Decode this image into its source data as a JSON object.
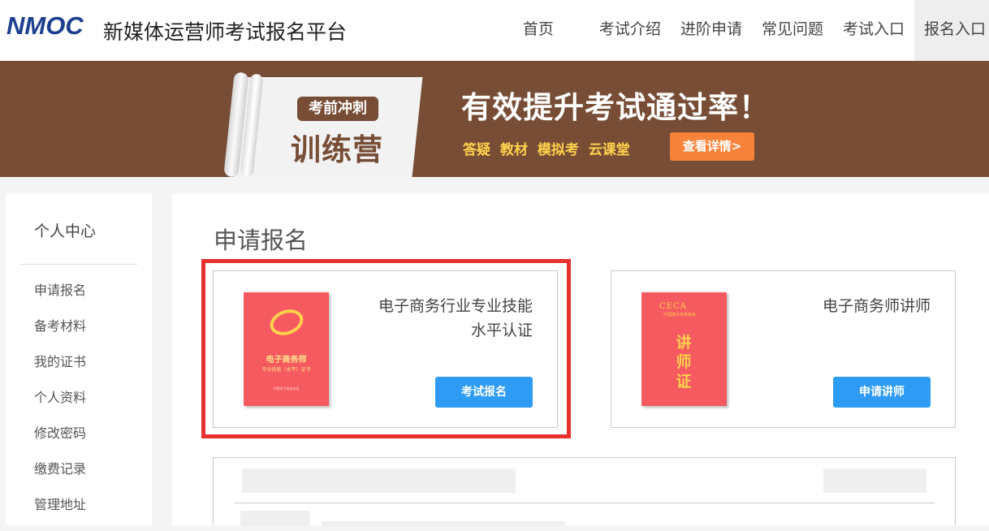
{
  "header": {
    "logo": "NMOC",
    "site_title": "新媒体运营师考试报名平台",
    "nav": [
      "首页",
      "考试介绍",
      "进阶申请",
      "常见问题",
      "考试入口",
      "报名入口"
    ],
    "active_nav": "报名入口"
  },
  "banner": {
    "tag": "考前冲刺",
    "big_text": "训练营",
    "headline": "有效提升考试通过率！",
    "features": "答疑 教材 模拟考 云课堂",
    "button_label": "查看详情>"
  },
  "sidebar": {
    "title": "个人中心",
    "items": [
      "申请报名",
      "备考材料",
      "我的证书",
      "个人资料",
      "修改密码",
      "缴费记录",
      "管理地址"
    ]
  },
  "main": {
    "title": "申请报名",
    "cards": [
      {
        "name_line1": "电子商务行业专业技能",
        "name_line2": "水平认证",
        "button_label": "考试报名",
        "cert_text1": "电子商务师",
        "cert_text2": "专业技能（水平）证书",
        "cert_text3": "中国电子商务协会"
      },
      {
        "name_line1": "电子商务师讲师",
        "name_line2": "",
        "button_label": "申请讲师",
        "cert_logo": "CECA",
        "cert_sub": "中国电子商务协会",
        "cert_vertical": "讲师证"
      }
    ]
  },
  "colors": {
    "logo_blue": "#1c3f8f",
    "banner_brown": "#774d35",
    "accent_yellow": "#ffd24c",
    "cta_orange": "#f7833a",
    "button_blue": "#2e9cf5",
    "highlight_red": "#e8302f",
    "cert_red": "#f55a60"
  }
}
